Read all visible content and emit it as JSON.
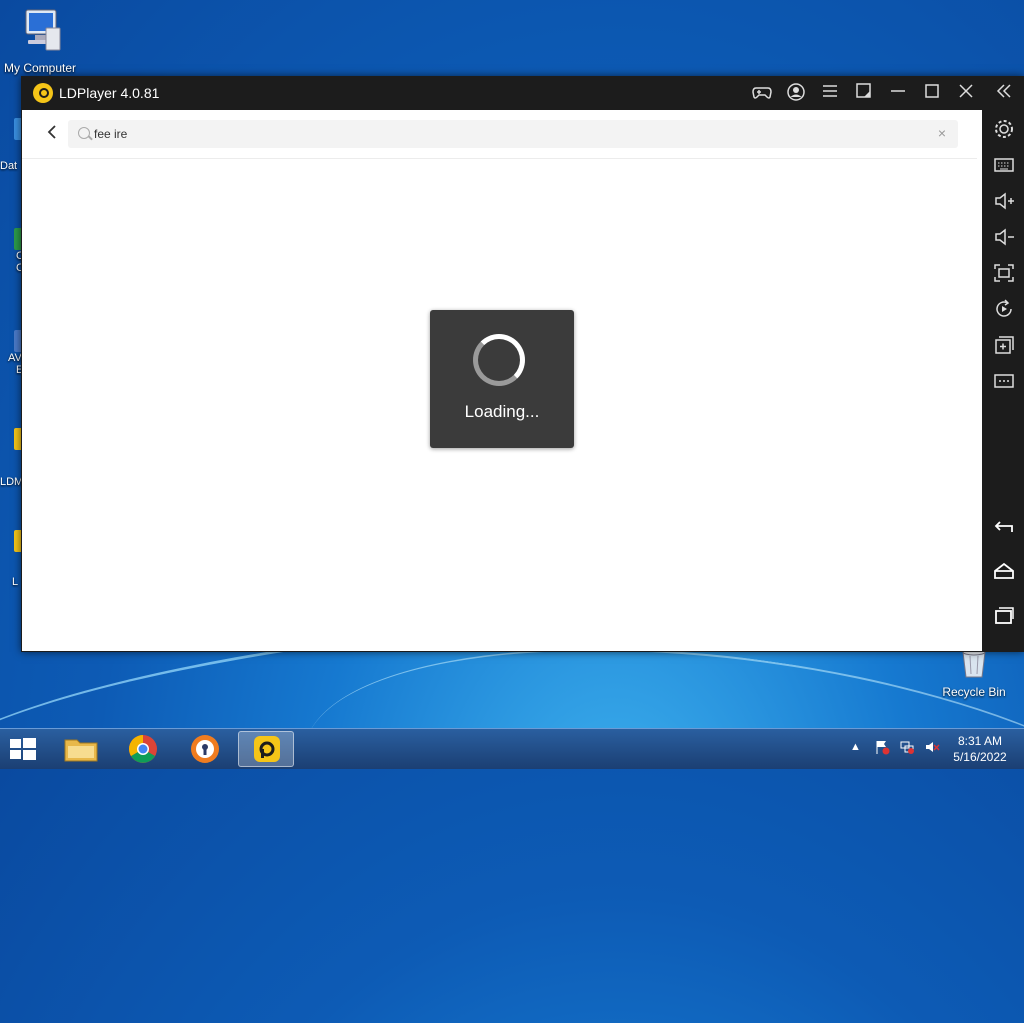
{
  "desktop": {
    "my_computer_label": "My Computer",
    "recycle_bin_label": "Recycle Bin",
    "partial_labels": [
      "Dat",
      "C",
      "C",
      "AV",
      "E",
      "LDM",
      "L"
    ]
  },
  "window": {
    "title": "LDPlayer 4.0.81",
    "search": {
      "value": "fee ire"
    },
    "loading_text": "Loading..."
  },
  "taskbar": {
    "time": "8:31 AM",
    "date": "5/16/2022"
  },
  "colors": {
    "accent": "#f5c518",
    "titlebar": "#1c1c1c",
    "loading_bg": "#3b3b3b"
  }
}
